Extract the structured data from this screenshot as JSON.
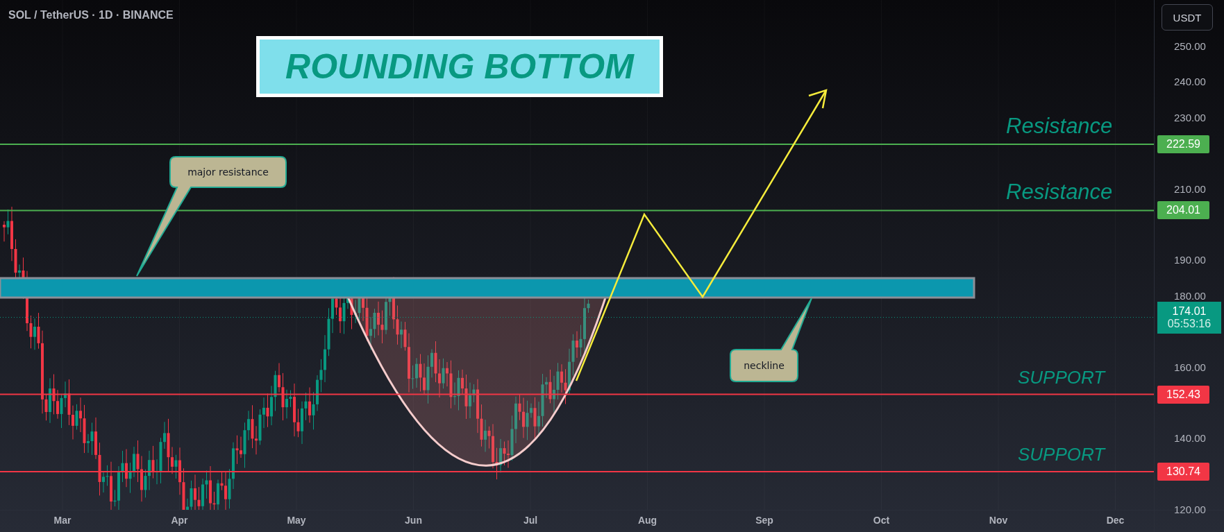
{
  "header": {
    "symbol": "SOL / TetherUS · 1D · BINANCE"
  },
  "currency_button": {
    "label": "USDT"
  },
  "title_banner": {
    "text": "ROUNDING BOTTOM"
  },
  "price_axis": {
    "ticks": [
      "250.00",
      "240.00",
      "230.00",
      "210.00",
      "190.00",
      "180.00",
      "160.00",
      "140.00",
      "120.00"
    ]
  },
  "levels": [
    {
      "kind": "resistance",
      "label": "Resistance",
      "price": "222.59",
      "color": "#4caf50"
    },
    {
      "kind": "resistance",
      "label": "Resistance",
      "price": "204.01",
      "color": "#4caf50"
    },
    {
      "kind": "support",
      "label": "SUPPORT",
      "price": "152.43",
      "color": "#f23645"
    },
    {
      "kind": "support",
      "label": "SUPPORT",
      "price": "130.74",
      "color": "#f23645"
    }
  ],
  "last_price": {
    "price": "174.01",
    "countdown": "05:53:16"
  },
  "callouts": [
    {
      "text": "major resistance"
    },
    {
      "text": "neckline"
    }
  ],
  "time_axis": {
    "months": [
      "Mar",
      "Apr",
      "May",
      "Jun",
      "Jul",
      "Aug",
      "Sep",
      "Oct",
      "Nov",
      "Dec"
    ]
  }
}
